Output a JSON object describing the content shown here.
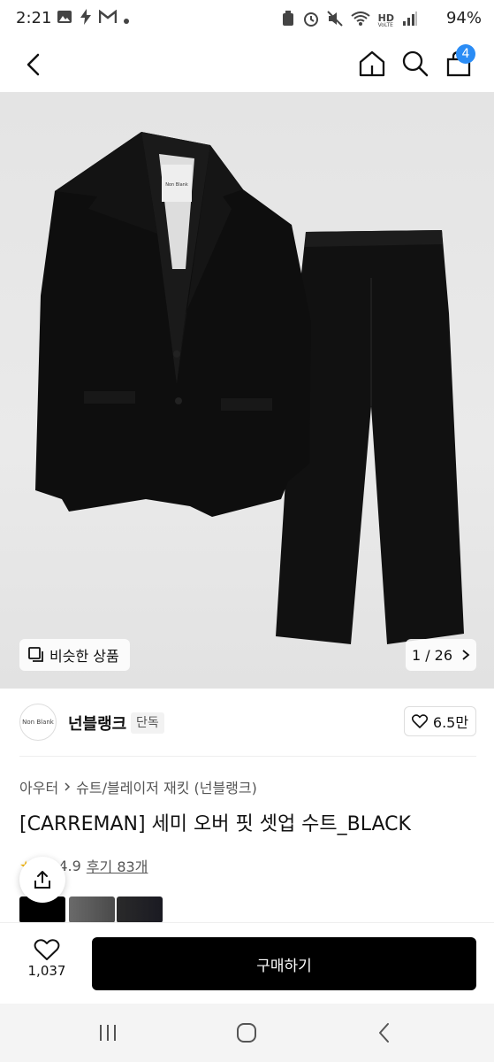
{
  "status": {
    "time": "2:21",
    "battery": "94%",
    "hd_label": "HD",
    "voice_label": "VoLTE"
  },
  "header": {
    "cart_count": "4"
  },
  "hero": {
    "similar_label": "비슷한 상품",
    "page_counter": "1 / 26",
    "tag_text": "Non Blank"
  },
  "brand": {
    "name": "넌블랭크",
    "tag": "단독",
    "logo_text": "Non Blank",
    "likes": "6.5만"
  },
  "breadcrumb": {
    "level1": "아우터",
    "level2": "슈트/블레이저 재킷 (넌블랭크)"
  },
  "product": {
    "title": "[CARREMAN] 세미 오버 핏 셋업 수트_BLACK"
  },
  "reviews": {
    "label": "후기 83개",
    "rating": "4.9"
  },
  "action": {
    "wish_count": "1,037",
    "buy_label": "구매하기"
  },
  "colors": {
    "accent": "#2a8cf5",
    "buy": "#000000"
  },
  "icons": [
    "back-icon",
    "home-icon",
    "search-icon",
    "cart-icon",
    "heart-icon",
    "share-icon",
    "similar-icon",
    "chevron-right-icon",
    "recent-apps-icon",
    "home-nav-icon",
    "back-nav-icon"
  ]
}
